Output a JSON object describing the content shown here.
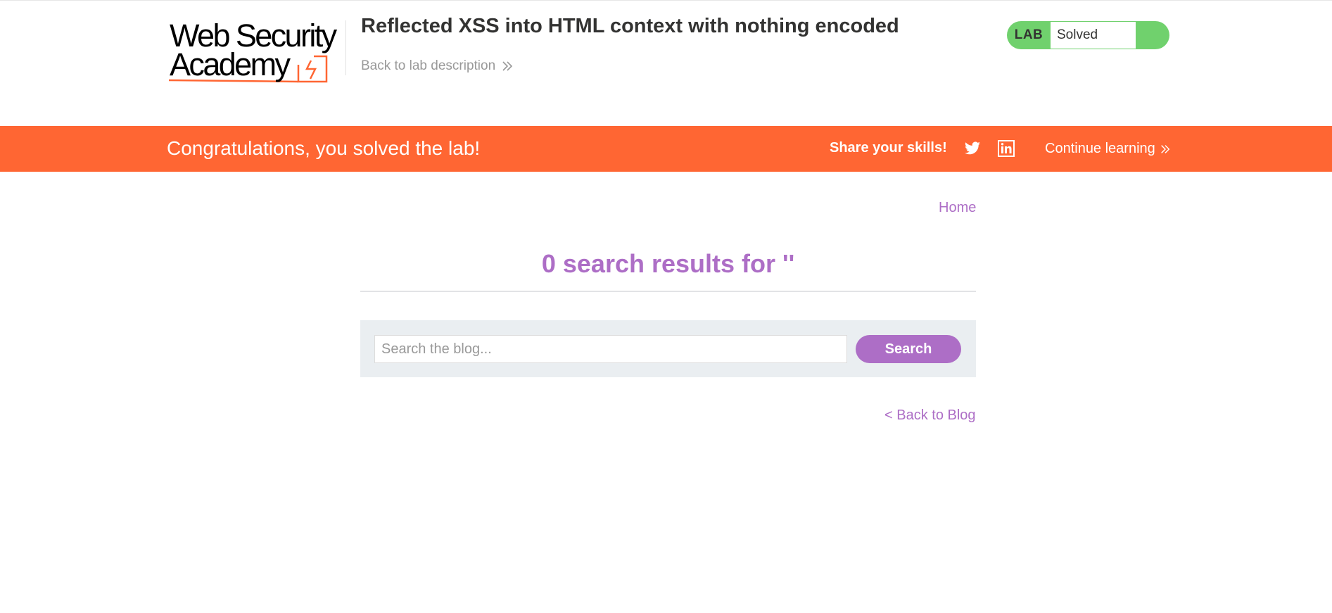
{
  "header": {
    "logo": {
      "line1": "Web Security",
      "line2": "Academy"
    },
    "lab_title": "Reflected XSS into HTML context with nothing encoded",
    "back_link": "Back to lab description",
    "lab_status": {
      "tag": "LAB",
      "state": "Solved"
    }
  },
  "banner": {
    "message": "Congratulations, you solved the lab!",
    "share_label": "Share your skills!",
    "share_icons": [
      "twitter-icon",
      "linkedin-icon"
    ],
    "continue_label": "Continue learning"
  },
  "nav": {
    "home": "Home"
  },
  "results": {
    "title": "0 search results for ''"
  },
  "search": {
    "placeholder": "Search the blog...",
    "value": "",
    "button": "Search"
  },
  "footer_link": "< Back to Blog",
  "colors": {
    "brand_orange": "#ff6633",
    "accent_purple": "#ad6ec6",
    "status_green": "#70d16d",
    "panel_gray": "#eaeef1"
  }
}
